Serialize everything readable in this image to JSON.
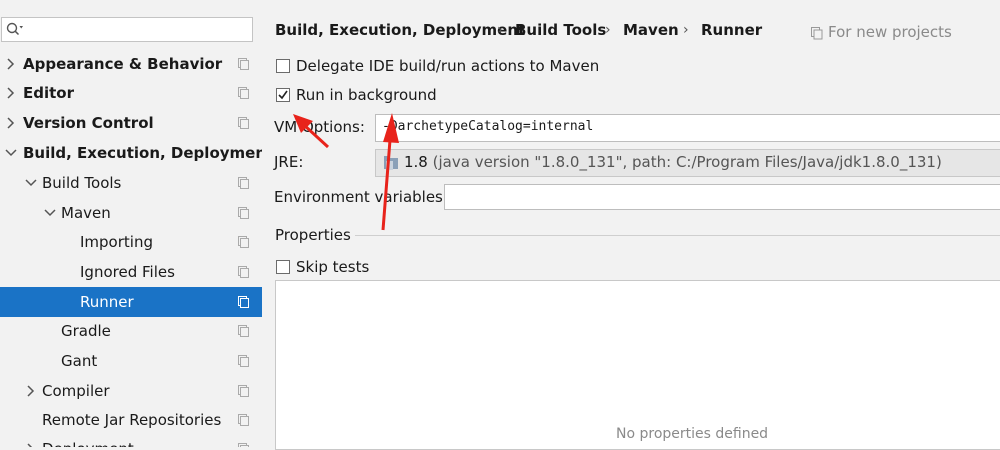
{
  "sidebar": {
    "search_placeholder": "",
    "items": [
      {
        "label": "Appearance & Behavior"
      },
      {
        "label": "Editor"
      },
      {
        "label": "Version Control"
      },
      {
        "label": "Build, Execution, Deployment"
      },
      {
        "label": "Build Tools"
      },
      {
        "label": "Maven"
      },
      {
        "label": "Importing"
      },
      {
        "label": "Ignored Files"
      },
      {
        "label": "Runner"
      },
      {
        "label": "Gradle"
      },
      {
        "label": "Gant"
      },
      {
        "label": "Compiler"
      },
      {
        "label": "Remote Jar Repositories"
      },
      {
        "label": "Deployment"
      }
    ],
    "selected": "Runner"
  },
  "breadcrumb": {
    "items": [
      "Build, Execution, Deployment",
      "Build Tools",
      "Maven",
      "Runner"
    ],
    "separator": "›"
  },
  "scope_note": "For new projects",
  "options": {
    "delegate_label": "Delegate IDE build/run actions to Maven",
    "delegate_checked": false,
    "background_label": "Run in background",
    "background_checked": true
  },
  "vm_options": {
    "label": "VM Options:",
    "value": "-DarchetypeCatalog=internal"
  },
  "jre": {
    "label": "JRE:",
    "version": "1.8",
    "details": "(java version \"1.8.0_131\", path: C:/Program Files/Java/jdk1.8.0_131)"
  },
  "env_vars": {
    "label": "Environment variables:",
    "value": ""
  },
  "properties": {
    "section_label": "Properties",
    "skip_tests_label": "Skip tests",
    "skip_tests_checked": false,
    "empty_text": "No properties defined"
  },
  "colors": {
    "selection": "#1a73c6",
    "annotation_arrow": "#e8231b"
  }
}
